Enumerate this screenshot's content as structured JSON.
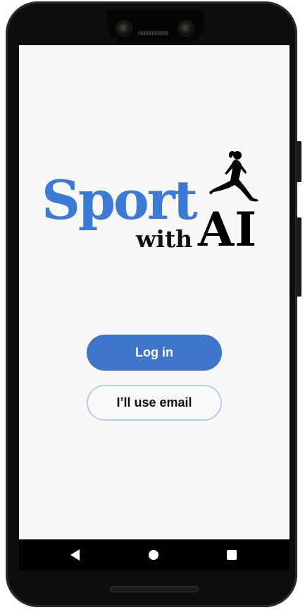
{
  "app": {
    "logo": {
      "word_sport": "Sport",
      "word_with": "with",
      "word_ai": "AI",
      "brand_color": "#3b7ad6",
      "icon": "runner-silhouette-icon"
    }
  },
  "buttons": {
    "login_label": "Log in",
    "email_label": "I’ll use email",
    "primary_color": "#3f76cc",
    "secondary_border_color": "#b9cdea"
  },
  "system_nav": {
    "back_icon": "back-triangle-icon",
    "home_icon": "home-circle-icon",
    "recents_icon": "recents-square-icon"
  }
}
